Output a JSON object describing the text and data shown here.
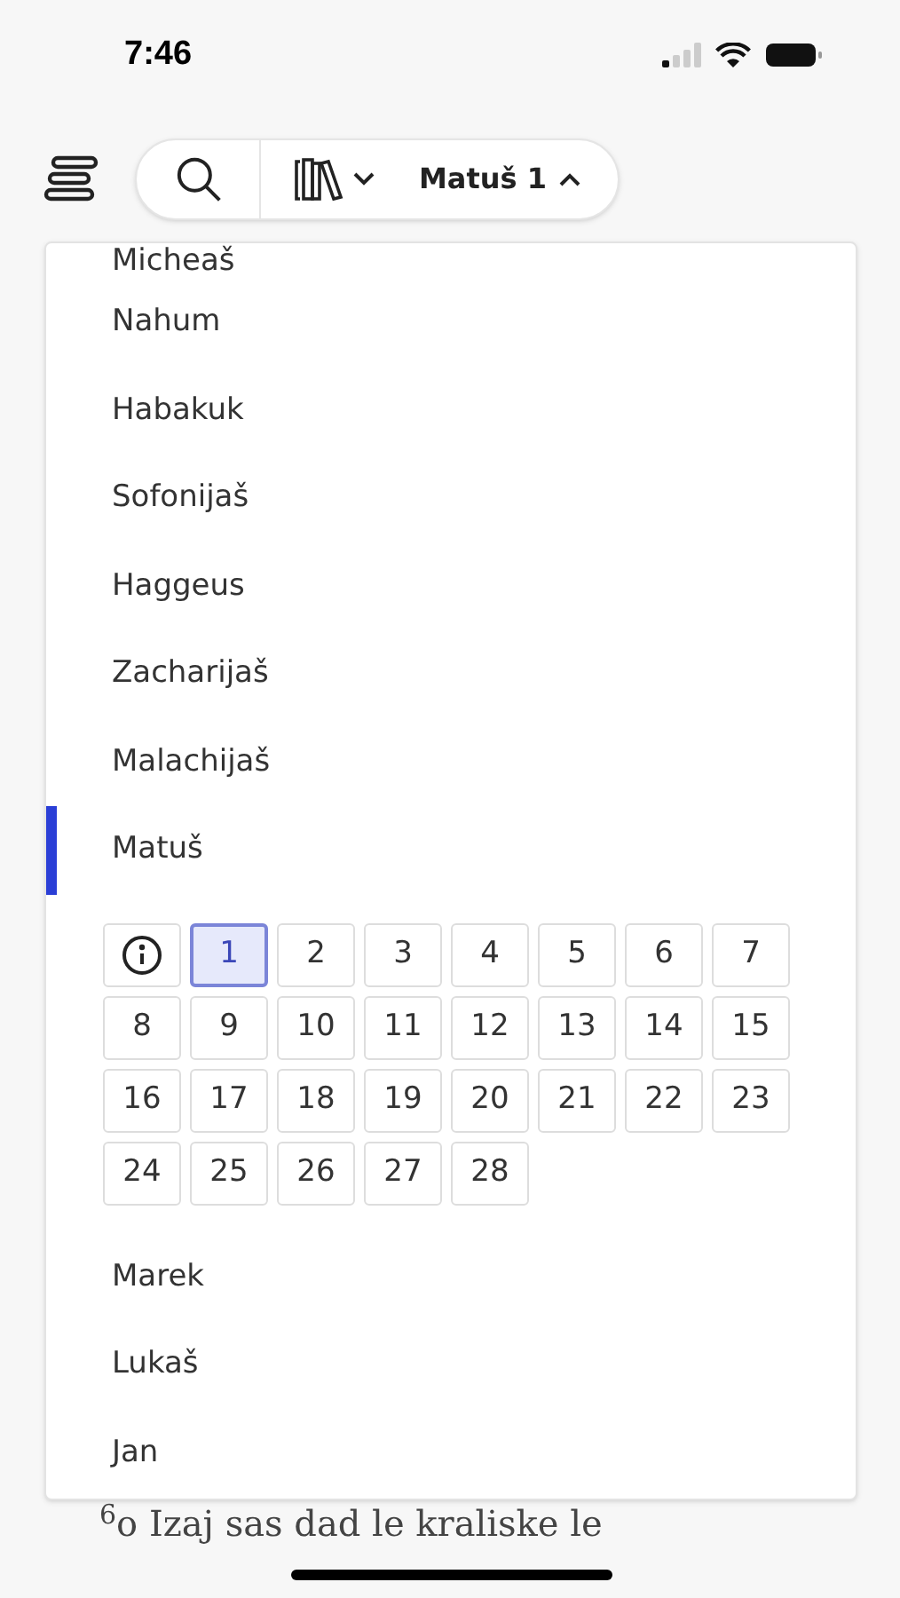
{
  "status_bar": {
    "time": "7:46"
  },
  "header": {
    "reference": "Matuš 1"
  },
  "books": [
    {
      "name": "Micheaš",
      "selected": false
    },
    {
      "name": "Nahum",
      "selected": false
    },
    {
      "name": "Habakuk",
      "selected": false
    },
    {
      "name": "Sofonijaš",
      "selected": false
    },
    {
      "name": "Haggeus",
      "selected": false
    },
    {
      "name": "Zacharijaš",
      "selected": false
    },
    {
      "name": "Malachijaš",
      "selected": false
    },
    {
      "name": "Matuš",
      "selected": true,
      "expanded": true
    },
    {
      "name": "Marek",
      "selected": false
    },
    {
      "name": "Lukaš",
      "selected": false
    },
    {
      "name": "Jan",
      "selected": false
    }
  ],
  "chapters": [
    {
      "label": "1",
      "selected": true
    },
    {
      "label": "2",
      "selected": false
    },
    {
      "label": "3",
      "selected": false
    },
    {
      "label": "4",
      "selected": false
    },
    {
      "label": "5",
      "selected": false
    },
    {
      "label": "6",
      "selected": false
    },
    {
      "label": "7",
      "selected": false
    },
    {
      "label": "8",
      "selected": false
    },
    {
      "label": "9",
      "selected": false
    },
    {
      "label": "10",
      "selected": false
    },
    {
      "label": "11",
      "selected": false
    },
    {
      "label": "12",
      "selected": false
    },
    {
      "label": "13",
      "selected": false
    },
    {
      "label": "14",
      "selected": false
    },
    {
      "label": "15",
      "selected": false
    },
    {
      "label": "16",
      "selected": false
    },
    {
      "label": "17",
      "selected": false
    },
    {
      "label": "18",
      "selected": false
    },
    {
      "label": "19",
      "selected": false
    },
    {
      "label": "20",
      "selected": false
    },
    {
      "label": "21",
      "selected": false
    },
    {
      "label": "22",
      "selected": false
    },
    {
      "label": "23",
      "selected": false
    },
    {
      "label": "24",
      "selected": false
    },
    {
      "label": "25",
      "selected": false
    },
    {
      "label": "26",
      "selected": false
    },
    {
      "label": "27",
      "selected": false
    },
    {
      "label": "28",
      "selected": false
    }
  ],
  "background_text": "$^{6}$o Izaj sas dad le kraliske le"
}
